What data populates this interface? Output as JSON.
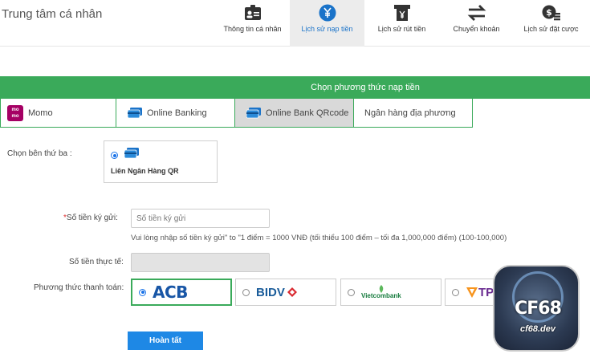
{
  "header": {
    "title": "Trung tâm cá nhân",
    "nav": [
      {
        "label": "Thông tin cá nhân",
        "icon": "id-card-icon"
      },
      {
        "label": "Lịch sử nạp tiền",
        "icon": "yen-coin-icon"
      },
      {
        "label": "Lịch sử rút tiền",
        "icon": "atm-icon"
      },
      {
        "label": "Chuyển khoản",
        "icon": "transfer-arrows-icon"
      },
      {
        "label": "Lịch sử đặt cược",
        "icon": "dollar-coins-icon"
      }
    ]
  },
  "method_bar": {
    "title": "Chọn phương thức nạp tiền"
  },
  "tabs": [
    {
      "label": "Momo",
      "logo_lines": [
        "mo",
        "mo"
      ]
    },
    {
      "label": "Online Banking"
    },
    {
      "label": "Online Bank QRcode"
    },
    {
      "label": "Ngân hàng địa phương"
    }
  ],
  "third_party": {
    "label": "Chọn bên thứ ba :",
    "option": "Liên Ngân Hàng QR"
  },
  "form": {
    "amount_label_required": "*",
    "amount_label": "Số tiền ký gửi:",
    "amount_placeholder": "Số tiền ký gửi",
    "hint": "Vui lòng nhập số tiền ký gửi\" to \"1 điểm = 1000 VNĐ (tối thiểu 100 điểm – tối đa 1,000,000 điểm) (100-100,000)",
    "actual_label": "Số tiền thực tế:",
    "payment_label": "Phương thức thanh toán:",
    "submit_label": "Hoàn tất"
  },
  "banks": [
    {
      "name": "ACB",
      "selected": true
    },
    {
      "name": "BIDV",
      "selected": false
    },
    {
      "name": "Vietcombank",
      "selected": false
    },
    {
      "name": "TP",
      "selected": false
    }
  ],
  "watermark": {
    "brand": "CF68",
    "site": "cf68.dev"
  },
  "colors": {
    "green": "#3aaa5a",
    "blue": "#1e88e5",
    "acb": "#1856a6"
  }
}
